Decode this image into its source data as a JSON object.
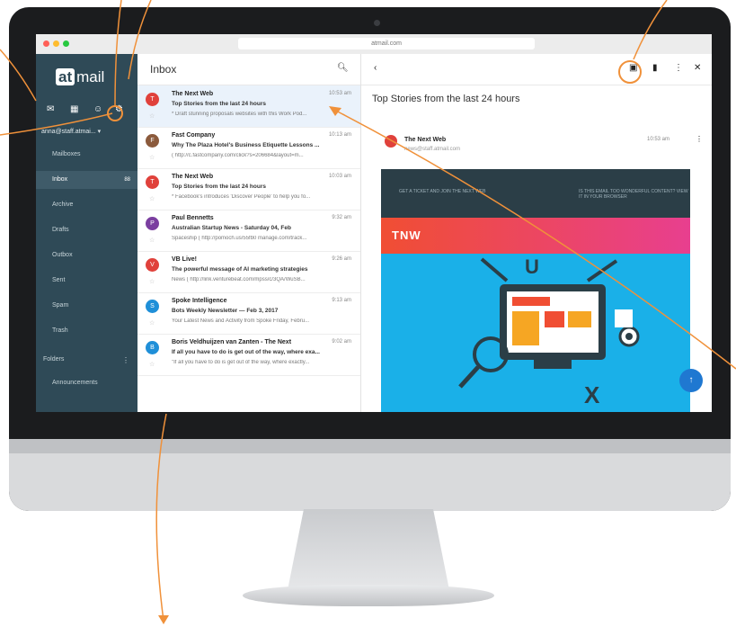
{
  "browser": {
    "url": "atmail.com"
  },
  "logo": {
    "at": "at",
    "rest": "mail"
  },
  "sidebar": {
    "account": "anna@staff.atmai...",
    "items": [
      {
        "label": "Mailboxes"
      },
      {
        "label": "Inbox",
        "count": "88"
      },
      {
        "label": "Archive"
      },
      {
        "label": "Drafts"
      },
      {
        "label": "Outbox"
      },
      {
        "label": "Sent"
      },
      {
        "label": "Spam"
      },
      {
        "label": "Trash"
      },
      {
        "label": "Folders"
      },
      {
        "label": "Announcements"
      }
    ]
  },
  "list": {
    "title": "Inbox",
    "rows": [
      {
        "initial": "T",
        "color": "#e0413b",
        "sender": "The Next Web",
        "time": "10:53 am",
        "subject": "Top Stories from the last 24 hours",
        "preview": "* Draft stunning proposals websites with this Work Pod..."
      },
      {
        "initial": "F",
        "color": "#8b5a3c",
        "sender": "Fast Company",
        "time": "10:13 am",
        "subject": "Why The Plaza Hotel's Business Etiquette Lessons ...",
        "preview": "( http://c.fastcompany.com/click?s=206684&layout=m..."
      },
      {
        "initial": "T",
        "color": "#e0413b",
        "sender": "The Next Web",
        "time": "10:03 am",
        "subject": "Top Stories from the last 24 hours",
        "preview": "* Facebook's introduces 'Discover People' to help you fo..."
      },
      {
        "initial": "P",
        "color": "#7b3fa0",
        "sender": "Paul Bennetts",
        "time": "9:32 am",
        "subject": "Australian Startup News - Saturday 04, Feb",
        "preview": "Spaceship ( http://pomoch.us/55fb0 manage.com/track..."
      },
      {
        "initial": "V",
        "color": "#e0413b",
        "sender": "VB Live!",
        "time": "9:26 am",
        "subject": "The powerful message of AI marketing strategies",
        "preview": "News ( http://link.venturebeat.com/mpss/c/3QA/WuSB..."
      },
      {
        "initial": "S",
        "color": "#1f8fd8",
        "sender": "Spoke Intelligence",
        "time": "9:13 am",
        "subject": "Bots Weekly Newsletter — Feb 3, 2017",
        "preview": "Your Latest News and Activity from Spoke Friday, Febru..."
      },
      {
        "initial": "B",
        "color": "#1f8fd8",
        "sender": "Boris Veldhuijzen van Zanten - The Next",
        "time": "9:02 am",
        "subject": "If all you have to do is get out of the way, where exa...",
        "preview": "\"If all you have to do is get out of the way, where exactly..."
      }
    ]
  },
  "reading": {
    "subject": "Top Stories from the last 24 hours",
    "sender": "The Next Web",
    "sender_address": "news@staff.atmail.com",
    "time": "10:53 am",
    "topbar_left": "GET A TICKET AND JOIN THE NEXT WEB",
    "topbar_right": "IS THIS EMAIL TOO WONDERFUL CONTENT? VIEW IT IN YOUR BROWSER",
    "brand": "TNW",
    "hero_letters": [
      "U",
      "X"
    ]
  },
  "colors": {
    "sidebar": "#2f4a57",
    "accent": "#1f78d1",
    "callout": "#f0913a"
  }
}
